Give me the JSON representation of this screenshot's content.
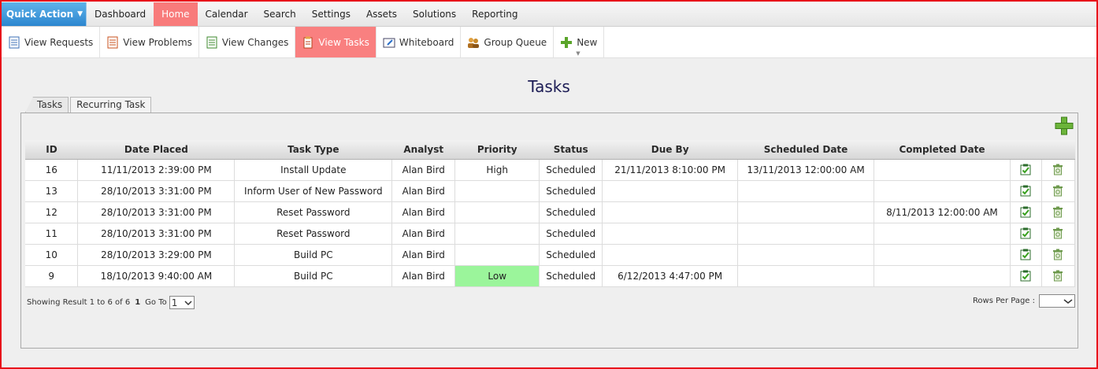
{
  "topnav": {
    "quick_action": "Quick Action",
    "items": [
      "Dashboard",
      "Home",
      "Calendar",
      "Search",
      "Settings",
      "Assets",
      "Solutions",
      "Reporting"
    ]
  },
  "subnav": {
    "items": [
      "View Requests",
      "View Problems",
      "View Changes",
      "View Tasks",
      "Whiteboard",
      "Group Queue",
      "New"
    ]
  },
  "page": {
    "title": "Tasks"
  },
  "tabs": [
    "Tasks",
    "Recurring Task"
  ],
  "table": {
    "columns": [
      "ID",
      "Date Placed",
      "Task Type",
      "Analyst",
      "Priority",
      "Status",
      "Due By",
      "Scheduled Date",
      "Completed Date"
    ],
    "rows": [
      [
        "16",
        "11/11/2013 2:39:00 PM",
        "Install Update",
        "Alan Bird",
        "High",
        "Scheduled",
        "21/11/2013 8:10:00 PM",
        "13/11/2013 12:00:00 AM",
        ""
      ],
      [
        "13",
        "28/10/2013 3:31:00 PM",
        "Inform User of New Password",
        "Alan Bird",
        "",
        "Scheduled",
        "",
        "",
        ""
      ],
      [
        "12",
        "28/10/2013 3:31:00 PM",
        "Reset Password",
        "Alan Bird",
        "",
        "Scheduled",
        "",
        "",
        "8/11/2013 12:00:00 AM"
      ],
      [
        "11",
        "28/10/2013 3:31:00 PM",
        "Reset Password",
        "Alan Bird",
        "",
        "Scheduled",
        "",
        "",
        ""
      ],
      [
        "10",
        "28/10/2013 3:29:00 PM",
        "Build PC",
        "Alan Bird",
        "",
        "Scheduled",
        "",
        "",
        ""
      ],
      [
        "9",
        "18/10/2013 9:40:00 AM",
        "Build PC",
        "Alan Bird",
        "Low",
        "Scheduled",
        "6/12/2013 4:47:00 PM",
        "",
        ""
      ]
    ],
    "highlight_color": "#9bf59b"
  },
  "footer": {
    "showing": "Showing Result 1 to 6 of 6",
    "current_page": "1",
    "goto_label": "Go To",
    "goto_value": "1",
    "rows_per_page_label": "Rows Per Page :"
  }
}
